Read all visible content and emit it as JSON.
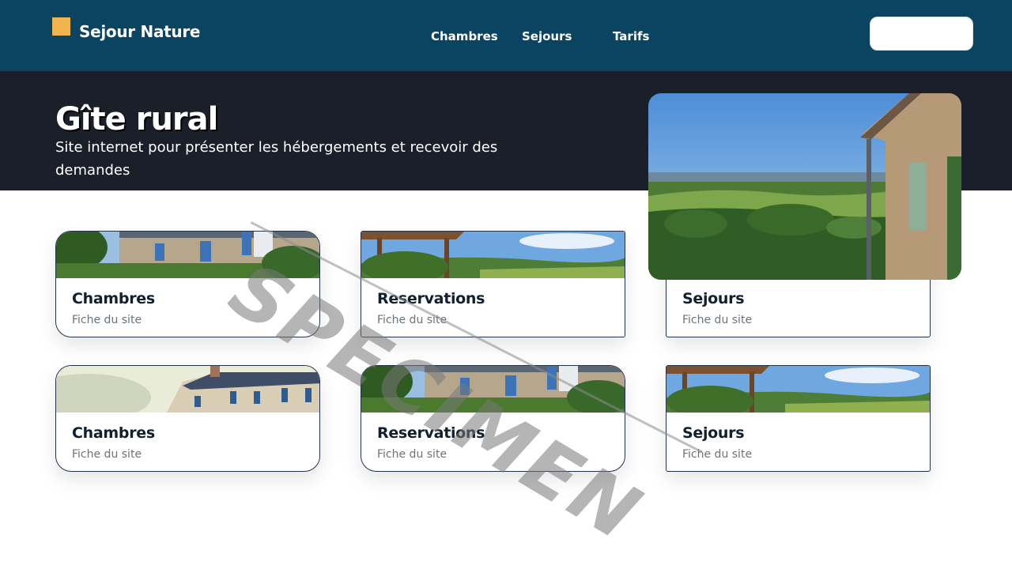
{
  "header": {
    "brand": "Sejour Nature",
    "nav": [
      "Chambres",
      "Sejours",
      "Tarifs"
    ],
    "cta_label": ""
  },
  "hero": {
    "title": "Gîte rural",
    "subtitle": "Site internet pour présenter les hébergements et recevoir des demandes"
  },
  "cards": [
    {
      "title": "Chambres",
      "subtitle": "Fiche du site",
      "image": "stone-house-photo"
    },
    {
      "title": "Reservations",
      "subtitle": "Fiche du site",
      "image": "countryside-pergola-photo"
    },
    {
      "title": "Sejours",
      "subtitle": "Fiche du site",
      "image": "pine-forest-photo"
    },
    {
      "title": "Chambres",
      "subtitle": "Fiche du site",
      "image": "manor-house-photo"
    },
    {
      "title": "Reservations",
      "subtitle": "Fiche du site",
      "image": "stone-house-photo"
    },
    {
      "title": "Sejours",
      "subtitle": "Fiche du site",
      "image": "countryside-pergola-photo"
    }
  ],
  "watermark": "SPECIMEN",
  "colors": {
    "header_bg": "#0b4460",
    "hero_bg": "#1a1f2a",
    "logo_accent": "#f2b54d",
    "card_border": "#233247"
  }
}
